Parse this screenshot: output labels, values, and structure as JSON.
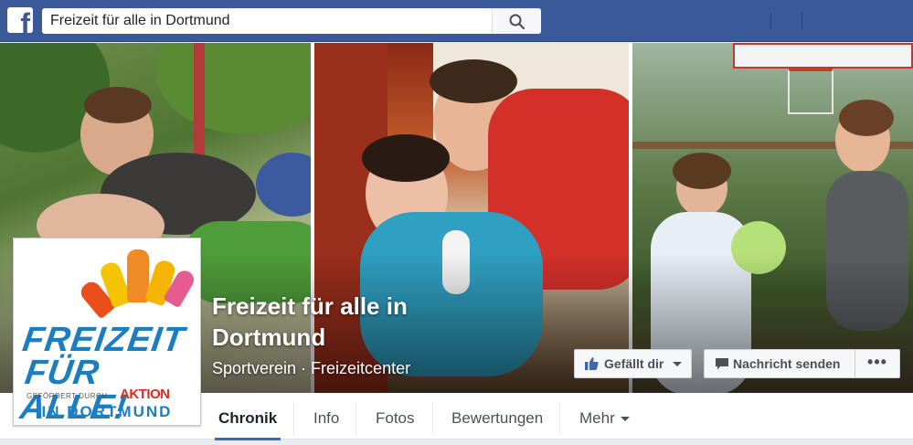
{
  "topbar": {
    "logo_letter": "f",
    "search_value": "Freizeit für alle in Dortmund"
  },
  "page": {
    "name": "Freizeit für alle in Dortmund",
    "category": "Sportverein · Freizeitcenter"
  },
  "profile_logo": {
    "line1": "FREIZEIT",
    "line2": "FÜR ALLE!",
    "sponsor_text": "GEFÖRDERT DURCH",
    "sponsor_brand": "AKTION",
    "city": "IN DORTMUND"
  },
  "actions": {
    "like_label": "Gefällt dir",
    "message_label": "Nachricht senden",
    "more_label": "•••"
  },
  "tabs": [
    {
      "label": "Chronik",
      "active": true
    },
    {
      "label": "Info",
      "active": false
    },
    {
      "label": "Fotos",
      "active": false
    },
    {
      "label": "Bewertungen",
      "active": false
    },
    {
      "label": "Mehr",
      "active": false
    }
  ],
  "colors": {
    "brand": "#3b5998",
    "accent": "#4267b2",
    "logo_blue": "#1c7ec2",
    "logo_red": "#d92b1f"
  },
  "icons": [
    "facebook-logo-icon",
    "search-icon",
    "thumbs-up-icon",
    "caret-down-icon",
    "message-icon"
  ]
}
